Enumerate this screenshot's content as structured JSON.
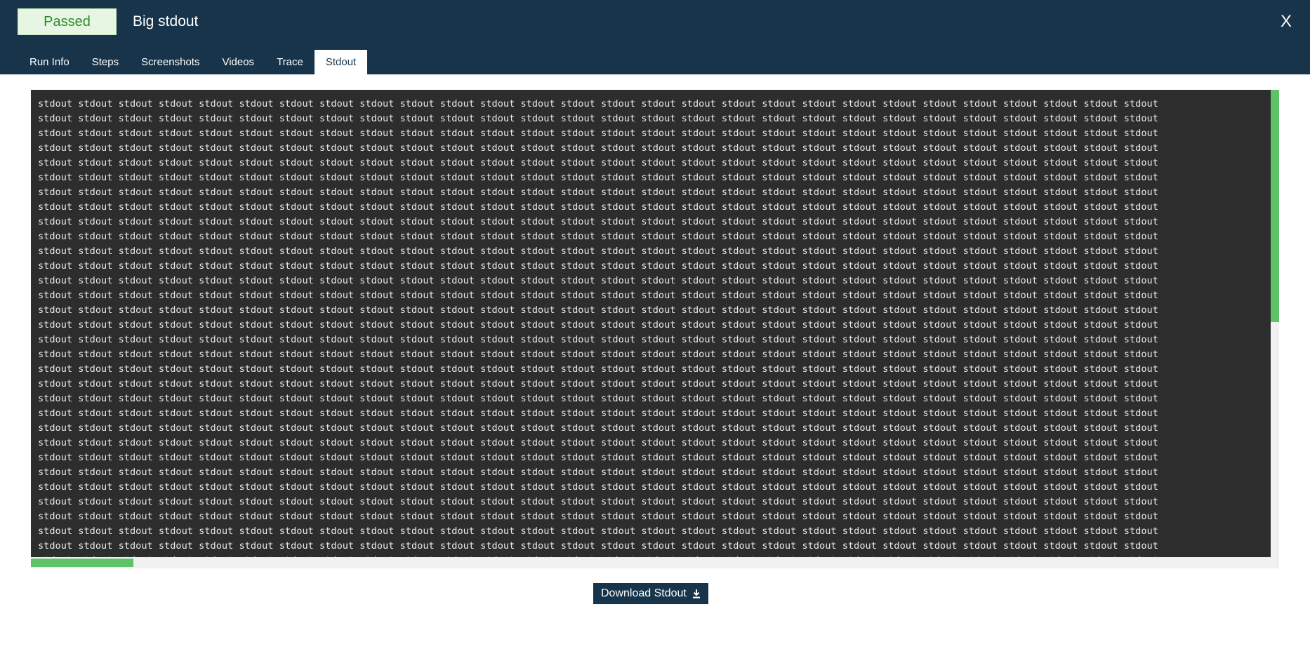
{
  "header": {
    "status": "Passed",
    "title": "Big stdout",
    "close_label": "X"
  },
  "tabs": [
    {
      "label": "Run Info"
    },
    {
      "label": "Steps"
    },
    {
      "label": "Screenshots"
    },
    {
      "label": "Videos"
    },
    {
      "label": "Trace"
    },
    {
      "label": "Stdout",
      "active": true
    }
  ],
  "stdout": {
    "word": "stdout",
    "words_per_line": 28,
    "visible_lines": 32
  },
  "download": {
    "label": "Download Stdout",
    "icon": "download-icon"
  },
  "colors": {
    "header_bg": "#17344a",
    "passed_bg": "#e7f6e2",
    "passed_text": "#2c8a2c",
    "console_bg": "#2d2d2d",
    "scroll_thumb": "#5ec269"
  }
}
